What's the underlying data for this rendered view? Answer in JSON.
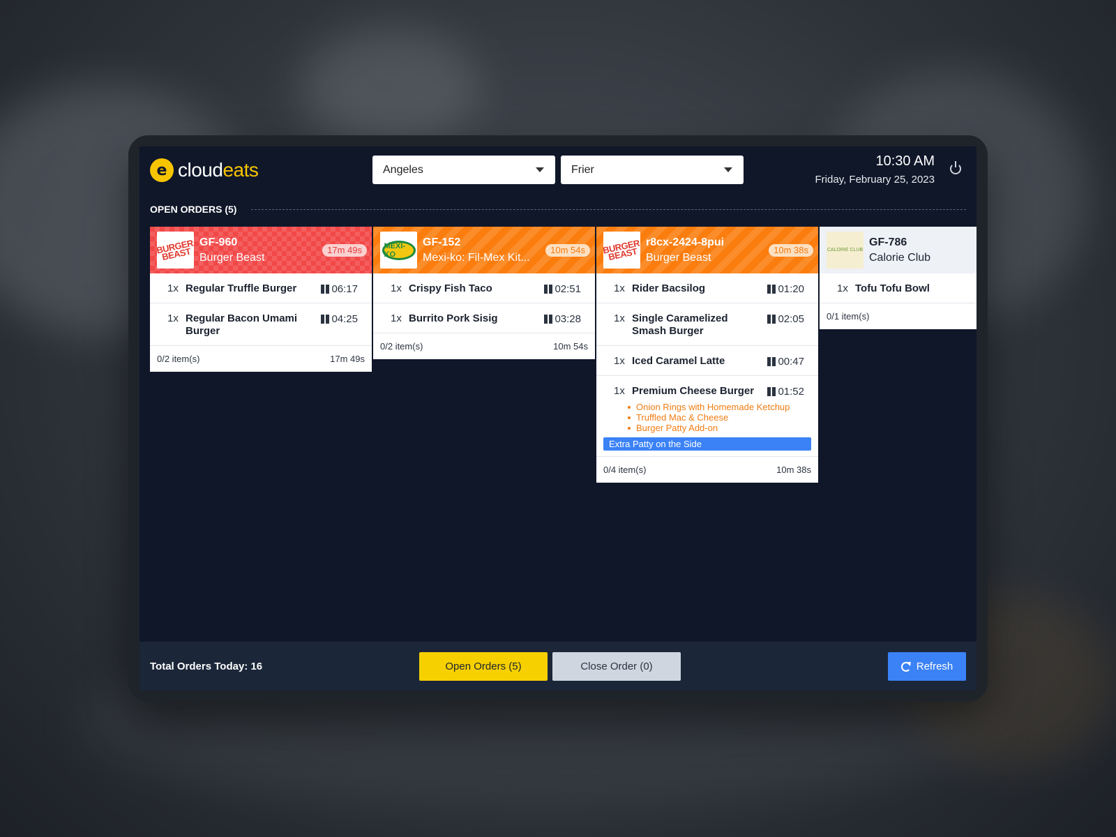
{
  "header": {
    "logo_icon": "e",
    "logo_part1": "cloud",
    "logo_part2": "eats",
    "location_select": "Angeles",
    "station_select": "Frier",
    "time": "10:30 AM",
    "date": "Friday, February 25, 2023"
  },
  "section": {
    "title": "OPEN ORDERS (5)"
  },
  "orders": [
    {
      "id": "GF-960",
      "brand": "Burger Beast",
      "brand_logo": "BURGER BEAST",
      "timer": "17m 49s",
      "color": "#f24848",
      "items": [
        {
          "qty": "1x",
          "name": "Regular Truffle Burger",
          "time": "06:17"
        },
        {
          "qty": "1x",
          "name": "Regular Bacon Umami Burger",
          "time": "04:25"
        }
      ],
      "progress": "0/2 item(s)",
      "footer_time": "17m 49s"
    },
    {
      "id": "GF-152",
      "brand": "Mexi-ko: Fil-Mex Kit...",
      "brand_logo": "MEXI-KO",
      "timer": "10m 54s",
      "color": "#fb7d0e",
      "items": [
        {
          "qty": "1x",
          "name": "Crispy Fish Taco",
          "time": "02:51"
        },
        {
          "qty": "1x",
          "name": "Burrito Pork Sisig",
          "time": "03:28"
        }
      ],
      "progress": "0/2 item(s)",
      "footer_time": "10m 54s"
    },
    {
      "id": "r8cx-2424-8pui",
      "brand": "Burger Beast",
      "brand_logo": "BURGER BEAST",
      "timer": "10m 38s",
      "color": "#fb7d0e",
      "items": [
        {
          "qty": "1x",
          "name": "Rider Bacsilog",
          "time": "01:20"
        },
        {
          "qty": "1x",
          "name": "Single Caramelized Smash Burger",
          "time": "02:05"
        },
        {
          "qty": "1x",
          "name": "Iced Caramel Latte",
          "time": "00:47"
        },
        {
          "qty": "1x",
          "name": "Premium Cheese Burger",
          "time": "01:52",
          "modifiers": [
            "Onion Rings with Homemade Ketchup",
            "Truffled Mac & Cheese",
            "Burger Patty Add-on"
          ]
        }
      ],
      "note": "Extra Patty on the Side",
      "progress": "0/4 item(s)",
      "footer_time": "10m 38s"
    },
    {
      "id": "GF-786",
      "brand": "Calorie Club",
      "brand_logo": "CALORIE CLUB",
      "items": [
        {
          "qty": "1x",
          "name": "Tofu Tofu Bowl"
        }
      ],
      "progress": "0/1 item(s)"
    }
  ],
  "footer": {
    "total": "Total Orders Today: 16",
    "open_label": "Open Orders (5)",
    "close_label": "Close Order (0)",
    "refresh_label": "Refresh"
  },
  "colors": {
    "accent": "#f7d000",
    "primary": "#3b82f6",
    "urgent": "#f24848",
    "warning": "#fb7d0e",
    "background": "#0f1729"
  },
  "icons": {
    "pause": "pause-icon",
    "power": "power-icon",
    "refresh": "refresh-icon",
    "dropdown": "chevron-down-icon"
  }
}
